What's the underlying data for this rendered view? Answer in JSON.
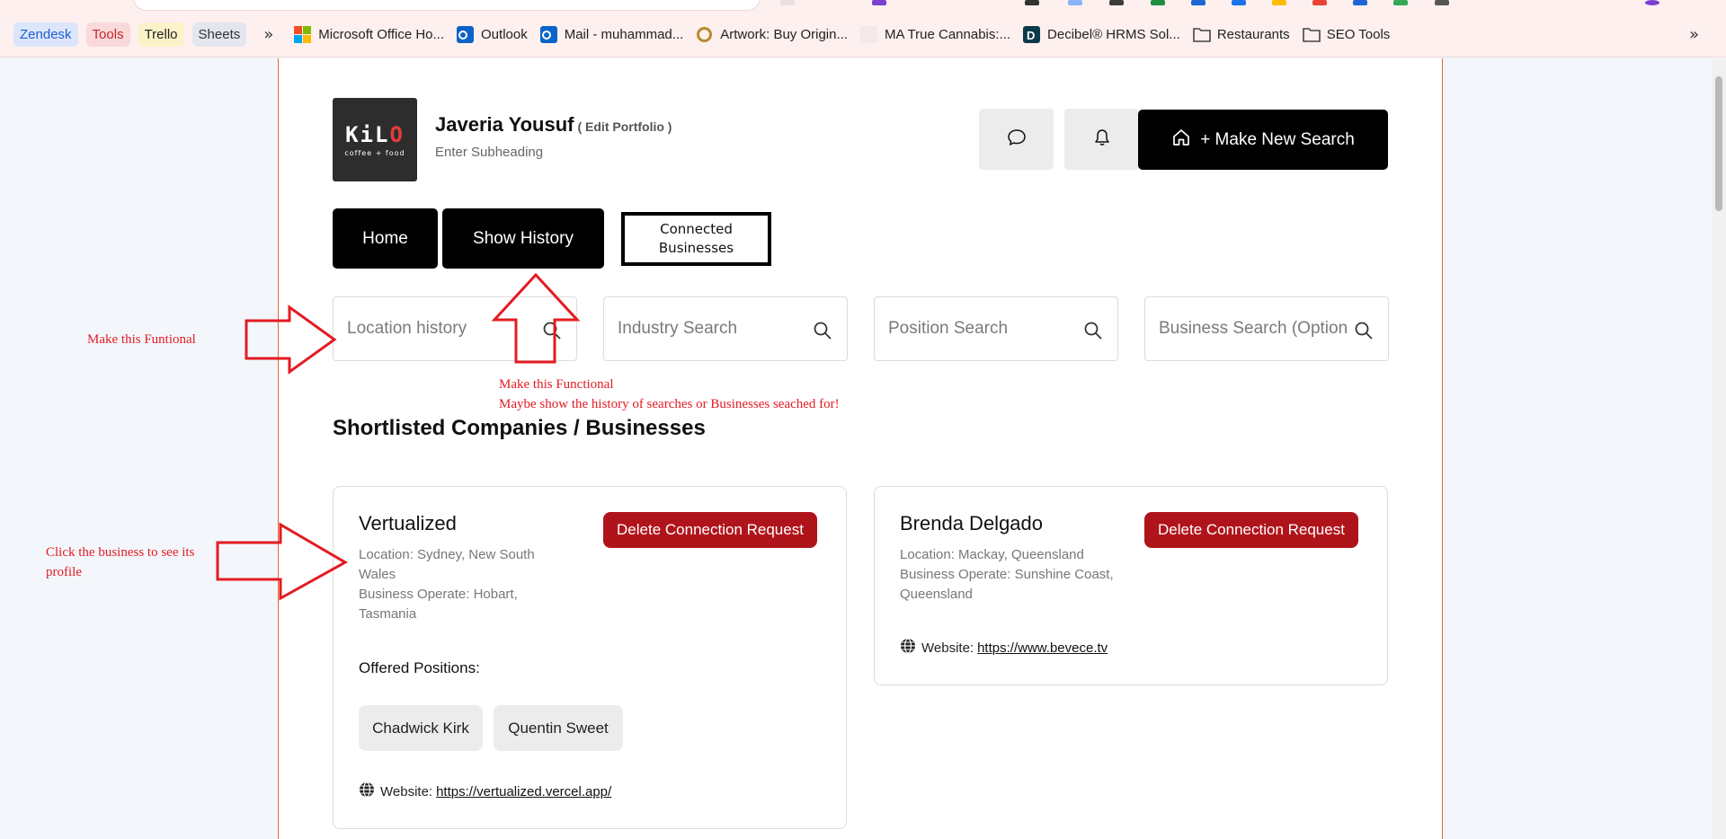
{
  "browser": {
    "bookmark_chips": [
      {
        "label": "Zendesk",
        "bg": "#dce6fb",
        "color": "#1f5fd1"
      },
      {
        "label": "Tools",
        "bg": "#f9d9d9",
        "color": "#c4262b"
      },
      {
        "label": "Trello",
        "bg": "#fbf2c8",
        "color": "#222222"
      },
      {
        "label": "Sheets",
        "bg": "#e3e6ee",
        "color": "#333333"
      }
    ],
    "bookmarks": [
      {
        "label": "Microsoft Office Ho...",
        "icon": "microsoft-icon"
      },
      {
        "label": "Outlook",
        "icon": "outlook-icon"
      },
      {
        "label": "Mail - muhammad...",
        "icon": "mail-icon"
      },
      {
        "label": "Artwork: Buy Origin...",
        "icon": "artwork-icon"
      },
      {
        "label": "MA True Cannabis:...",
        "icon": "cannabis-icon"
      },
      {
        "label": "Decibel® HRMS Sol...",
        "icon": "decibel-icon"
      },
      {
        "label": "Restaurants",
        "icon": "folder-icon"
      },
      {
        "label": "SEO Tools",
        "icon": "folder-icon"
      }
    ],
    "overflow_glyph": "»",
    "right_overflow_glyph": "»"
  },
  "header": {
    "logo_word": "KiL",
    "logo_word_end": "O",
    "logo_sub": "coffee + food",
    "name": "Javeria Yousuf",
    "edit_link": "( Edit Portfolio )",
    "subheading": "Enter Subheading",
    "new_search_label": "+ Make New Search"
  },
  "tabs": {
    "home": "Home",
    "show_history": "Show History",
    "connected": "Connected Businesses"
  },
  "search": {
    "location_placeholder": "Location history",
    "industry_placeholder": "Industry Search",
    "position_placeholder": "Position Search",
    "business_placeholder": "Business Search (Optional)"
  },
  "section_title": "Shortlisted Companies / Businesses",
  "cards": [
    {
      "title": "Vertualized",
      "location": "Location: Sydney, New South Wales",
      "operate": "Business Operate: Hobart, Tasmania",
      "delete_label": "Delete Connection Request",
      "positions_label": "Offered Positions:",
      "positions": [
        "Chadwick Kirk",
        "Quentin Sweet"
      ],
      "website_label": "Website:",
      "website_url": "https://vertualized.vercel.app/"
    },
    {
      "title": "Brenda Delgado",
      "location": "Location: Mackay, Queensland",
      "operate": "Business Operate: Sunshine Coast, Queensland",
      "delete_label": "Delete Connection Request",
      "website_label": "Website:",
      "website_url": "https://www.bevece.tv"
    }
  ],
  "annotations": {
    "location_note": "Make this Funtional",
    "history_note_line1": "Make this Functional",
    "history_note_line2": "Maybe show the history of searches or Businesses seached for!",
    "card_note": "Click the business to see its profile"
  },
  "colors": {
    "accent": "#000000",
    "danger": "#b0141b",
    "annotation": "#e31b23",
    "frame_border": "#e8662b"
  }
}
